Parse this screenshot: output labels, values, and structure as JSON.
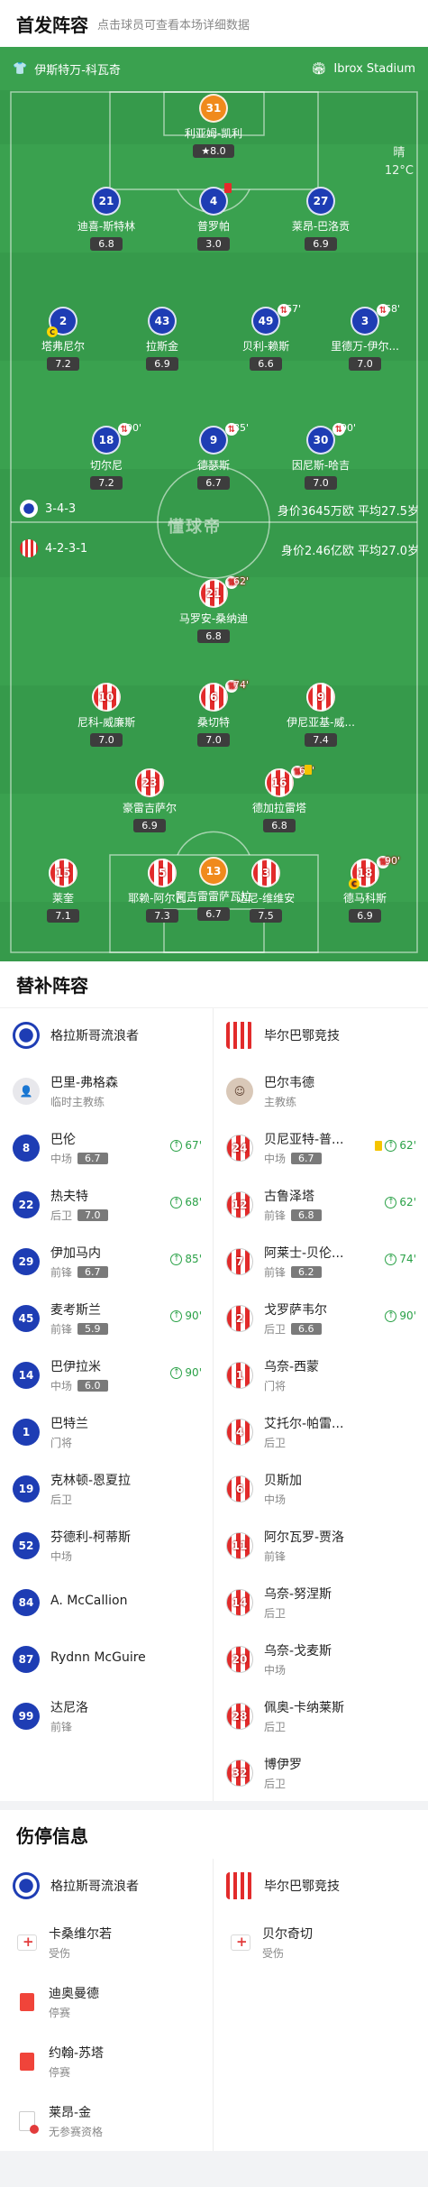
{
  "lineup": {
    "title": "首发阵容",
    "subtitle": "点击球员可查看本场详细数据"
  },
  "pitch": {
    "home_team": "伊斯特万-科瓦奇",
    "stadium": "Ibrox Stadium",
    "weather": "晴",
    "temp": "12°C",
    "home_formation": "3-4-3",
    "away_formation": "4-2-3-1",
    "home_value": "身价3645万欧  平均27.5岁",
    "away_value": "身价2.46亿欧  平均27.0岁",
    "watermark": "懂球帝"
  },
  "players": [
    {
      "num": "31",
      "name": "利亚姆-凯利",
      "rating": "★8.0",
      "team": "g"
    },
    {
      "num": "21",
      "name": "迪喜-斯特林",
      "rating": "6.8",
      "team": "r"
    },
    {
      "num": "4",
      "name": "普罗帕",
      "rating": "3.0",
      "team": "r",
      "card": "red"
    },
    {
      "num": "27",
      "name": "莱昂-巴洛贡",
      "rating": "6.9",
      "team": "r"
    },
    {
      "num": "2",
      "name": "塔弗尼尔",
      "rating": "7.2",
      "team": "r",
      "captain": "C"
    },
    {
      "num": "43",
      "name": "拉斯金",
      "rating": "6.9",
      "team": "r"
    },
    {
      "num": "49",
      "name": "贝利-赖斯",
      "rating": "6.6",
      "team": "r",
      "sub": "67'"
    },
    {
      "num": "3",
      "name": "里德万-伊尔...",
      "rating": "7.0",
      "team": "r",
      "sub": "68'"
    },
    {
      "num": "18",
      "name": "切尔尼",
      "rating": "7.2",
      "team": "r",
      "sub": "90'"
    },
    {
      "num": "9",
      "name": "德瑟斯",
      "rating": "6.7",
      "team": "r",
      "sub": "85'"
    },
    {
      "num": "30",
      "name": "因尼斯-哈吉",
      "rating": "7.0",
      "team": "r",
      "sub": "90'"
    },
    {
      "num": "21",
      "name": "马罗安-桑纳迪",
      "rating": "6.8",
      "team": "a",
      "sub": "62'"
    },
    {
      "num": "10",
      "name": "尼科-威廉斯",
      "rating": "7.0",
      "team": "a"
    },
    {
      "num": "6",
      "name": "桑切特",
      "rating": "7.0",
      "team": "a",
      "sub": "74'"
    },
    {
      "num": "9",
      "name": "伊尼亚基-威...",
      "rating": "7.4",
      "team": "a"
    },
    {
      "num": "23",
      "name": "豪雷吉萨尔",
      "rating": "6.9",
      "team": "a"
    },
    {
      "num": "16",
      "name": "德加拉雷塔",
      "rating": "6.8",
      "team": "a",
      "sub": "62'",
      "card": "yellow"
    },
    {
      "num": "15",
      "name": "莱奎",
      "rating": "7.1",
      "team": "a"
    },
    {
      "num": "5",
      "name": "耶赖-阿尔瓦...",
      "rating": "7.3",
      "team": "a"
    },
    {
      "num": "3",
      "name": "达尼-维维安",
      "rating": "7.5",
      "team": "a"
    },
    {
      "num": "18",
      "name": "德马科斯",
      "rating": "6.9",
      "team": "a",
      "sub": "90'",
      "captain": "C"
    },
    {
      "num": "13",
      "name": "阿吉雷雷萨瓦拉",
      "rating": "6.7",
      "team": "g"
    }
  ],
  "subs": {
    "title": "替补阵容",
    "home": {
      "team": "格拉斯哥流浪者",
      "coach": {
        "name": "巴里-弗格森",
        "role": "临时主教练"
      },
      "players": [
        {
          "num": "8",
          "name": "巴伦",
          "pos": "中场",
          "rating": "6.7",
          "event": "67'"
        },
        {
          "num": "22",
          "name": "热夫特",
          "pos": "后卫",
          "rating": "7.0",
          "event": "68'"
        },
        {
          "num": "29",
          "name": "伊加马内",
          "pos": "前锋",
          "rating": "6.7",
          "event": "85'"
        },
        {
          "num": "45",
          "name": "麦考斯兰",
          "pos": "前锋",
          "rating": "5.9",
          "event": "90'"
        },
        {
          "num": "14",
          "name": "巴伊拉米",
          "pos": "中场",
          "rating": "6.0",
          "event": "90'"
        },
        {
          "num": "1",
          "name": "巴特兰",
          "pos": "门将"
        },
        {
          "num": "19",
          "name": "克林顿-恩夏拉",
          "pos": "后卫"
        },
        {
          "num": "52",
          "name": "芬德利-柯蒂斯",
          "pos": "中场"
        },
        {
          "num": "84",
          "name": "A. McCallion",
          "pos": ""
        },
        {
          "num": "87",
          "name": "Rydnn McGuire",
          "pos": ""
        },
        {
          "num": "99",
          "name": "达尼洛",
          "pos": "前锋"
        }
      ]
    },
    "away": {
      "team": "毕尔巴鄂竞技",
      "coach": {
        "name": "巴尔韦德",
        "role": "主教练"
      },
      "players": [
        {
          "num": "24",
          "name": "贝尼亚特-普...",
          "pos": "中场",
          "rating": "6.7",
          "event": "62'",
          "card": "yellow"
        },
        {
          "num": "12",
          "name": "古鲁泽塔",
          "pos": "前锋",
          "rating": "6.8",
          "event": "62'"
        },
        {
          "num": "7",
          "name": "阿莱士-贝伦...",
          "pos": "前锋",
          "rating": "6.2",
          "event": "74'"
        },
        {
          "num": "2",
          "name": "戈罗萨韦尔",
          "pos": "后卫",
          "rating": "6.6",
          "event": "90'"
        },
        {
          "num": "1",
          "name": "乌奈-西蒙",
          "pos": "门将"
        },
        {
          "num": "4",
          "name": "艾托尔-帕雷...",
          "pos": "后卫"
        },
        {
          "num": "6",
          "name": "贝斯加",
          "pos": "中场"
        },
        {
          "num": "11",
          "name": "阿尔瓦罗-贾洛",
          "pos": "前锋"
        },
        {
          "num": "14",
          "name": "乌奈-努涅斯",
          "pos": "后卫"
        },
        {
          "num": "20",
          "name": "乌奈-戈麦斯",
          "pos": "中场"
        },
        {
          "num": "28",
          "name": "佩奥-卡纳莱斯",
          "pos": "后卫"
        },
        {
          "num": "32",
          "name": "博伊罗",
          "pos": "后卫"
        }
      ]
    }
  },
  "injuries": {
    "title": "伤停信息",
    "home": {
      "team": "格拉斯哥流浪者",
      "items": [
        {
          "name": "卡桑维尔若",
          "status": "受伤",
          "icon": "medkit-icon"
        },
        {
          "name": "迪奥曼德",
          "status": "停赛",
          "icon": "red-card-icon"
        },
        {
          "name": "约翰-苏塔",
          "status": "停赛",
          "icon": "red-card-icon"
        },
        {
          "name": "莱昂-金",
          "status": "无参赛资格",
          "icon": "ineligible-icon"
        }
      ]
    },
    "away": {
      "team": "毕尔巴鄂竞技",
      "items": [
        {
          "name": "贝尔奇切",
          "status": "受伤",
          "icon": "medkit-icon"
        }
      ]
    }
  },
  "colors": {
    "pitch": "#3aa14f",
    "rangers": "#1e3db4",
    "bilbao": "#e22b2b",
    "keeper": "#f08a1c"
  }
}
